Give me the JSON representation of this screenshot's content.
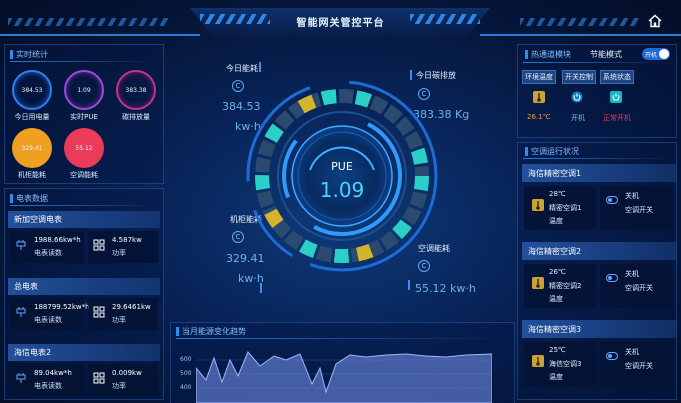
{
  "header": {
    "title": "智能网关管控平台"
  },
  "realtime": {
    "title": "实时统计",
    "stats": [
      {
        "value": "384.53",
        "label": "今日用电量"
      },
      {
        "value": "1.09",
        "label": "实时PUE"
      },
      {
        "value": "383.38",
        "label": "碳排放量"
      },
      {
        "value": "329.41",
        "label": "机柜能耗"
      },
      {
        "value": "55.12",
        "label": "空调能耗"
      }
    ]
  },
  "meters": {
    "title": "电表数据",
    "items": [
      {
        "name": "新加空调电表",
        "reading": "1988.66kw*h",
        "reading_label": "电表读数",
        "power": "4.587kw",
        "power_label": "功率"
      },
      {
        "name": "总电表",
        "reading": "188799.52kw*h",
        "reading_label": "电表读数",
        "power": "29.6461kw",
        "power_label": "功率"
      },
      {
        "name": "海信电表2",
        "reading": "89.04kw*h",
        "reading_label": "电表读数",
        "power": "0.009kw",
        "power_label": "功率"
      }
    ]
  },
  "center": {
    "today_energy_label": "今日能耗",
    "today_energy_value": "384.53",
    "today_energy_unit": "kw·h",
    "carbon_label": "今日碳排放",
    "carbon_value": "383.38 Kg",
    "cabinet_label": "机柜能耗",
    "cabinet_value": "329.41",
    "cabinet_unit": "kw·h",
    "ac_label": "空调能耗",
    "ac_value": "55.12 kw·h",
    "pue_label": "PUE",
    "pue_value": "1.09",
    "trend_title": "当月能源变化趋势",
    "trend_ticks": [
      "600",
      "500",
      "400"
    ]
  },
  "hotpath": {
    "title": "热通道模块",
    "mode_label": "节能模式",
    "toggle_text": "开机",
    "buttons": [
      "环境温度",
      "开关控制",
      "系统状态"
    ],
    "statuses": [
      "26.1℃",
      "开机",
      "正常开机"
    ]
  },
  "ac_status": {
    "title": "空调运行状况",
    "units": [
      {
        "name": "海信精密空调1",
        "temp": "28℃",
        "temp_label_1": "精密空调1",
        "temp_label_2": "温度",
        "state": "关机",
        "switch_label": "空调开关"
      },
      {
        "name": "海信精密空调2",
        "temp": "26℃",
        "temp_label_1": "精密空调2",
        "temp_label_2": "温度",
        "state": "关机",
        "switch_label": "空调开关"
      },
      {
        "name": "海信精密空调3",
        "temp": "25℃",
        "temp_label_1": "海信空调3",
        "temp_label_2": "温度",
        "state": "关机",
        "switch_label": "空调开关"
      }
    ]
  },
  "colors": {
    "accent": "#2f8df0",
    "warn": "#f0a020",
    "alert": "#ea3b5a",
    "ok_text": "#4dd0ff"
  },
  "icons": [
    "home-icon",
    "thermometer-icon",
    "power-icon",
    "grid-icon",
    "plug-icon",
    "fan-icon",
    "switch-icon",
    "leaf-icon"
  ]
}
